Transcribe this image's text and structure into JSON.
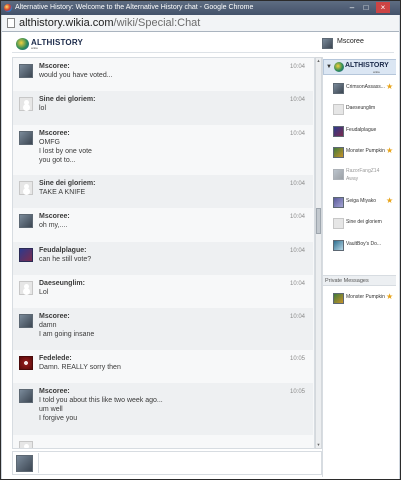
{
  "window": {
    "title": "Alternative History: Welcome to the Alternative History chat - Google Chrome"
  },
  "browser": {
    "url_host": "althistory.wikia.com",
    "url_path": "/wiki/Special:Chat"
  },
  "header": {
    "logo_text": "ALTHISTORY",
    "logo_sub": "wikia",
    "username": "Mscoree"
  },
  "messages": [
    {
      "name": "Mscoree:",
      "time": "10:04",
      "lines": [
        "would you have voted..."
      ],
      "avatar": "mscoree"
    },
    {
      "name": "Sine dei gloriem:",
      "time": "10:04",
      "lines": [
        "lol"
      ],
      "avatar": "generic"
    },
    {
      "name": "Mscoree:",
      "time": "10:04",
      "lines": [
        "OMFG",
        "I lost by one vote",
        "you got to..."
      ],
      "avatar": "mscoree"
    },
    {
      "name": "Sine dei gloriem:",
      "time": "10:04",
      "lines": [
        "TAKE A KNIFE"
      ],
      "avatar": "generic"
    },
    {
      "name": "Mscoree:",
      "time": "10:04",
      "lines": [
        "oh my,...."
      ],
      "avatar": "mscoree"
    },
    {
      "name": "Feudalplague:",
      "time": "10:04",
      "lines": [
        "can he still vote?"
      ],
      "avatar": "feudal"
    },
    {
      "name": "Daeseunglim:",
      "time": "10:04",
      "lines": [
        "Lol"
      ],
      "avatar": "generic"
    },
    {
      "name": "Mscoree:",
      "time": "10:04",
      "lines": [
        "damn",
        "I am going insane"
      ],
      "avatar": "mscoree"
    },
    {
      "name": "Fedelede:",
      "time": "10:05",
      "lines": [
        "Damn. REALLY sorry then"
      ],
      "avatar": "fedelede"
    },
    {
      "name": "Mscoree:",
      "time": "10:05",
      "lines": [
        "I told you about this like two week ago...",
        "um well",
        "I forgive you"
      ],
      "avatar": "mscoree"
    },
    {
      "name": "",
      "time": "",
      "lines": [],
      "avatar": "generic"
    }
  ],
  "sidebar": {
    "room_name": "ALTHISTORY",
    "room_sub": "wikia",
    "users": [
      {
        "name": "CrimsonAssass...",
        "star": true
      },
      {
        "name": "Daeseunglim",
        "star": false
      },
      {
        "name": "Feudalplague",
        "star": false
      },
      {
        "name": "Monster Pumpkin",
        "star": true
      },
      {
        "name": "RazorFangZ14",
        "status": "Away",
        "star": false
      },
      {
        "name": "Seiga Miyako",
        "star": true
      },
      {
        "name": "Sine dei gloriem",
        "star": false
      },
      {
        "name": "VaultBoy's Do...",
        "star": false
      }
    ],
    "pm_header": "Private Messages",
    "pm_users": [
      {
        "name": "Monster Pumpkin",
        "star": true
      }
    ]
  },
  "input": {
    "placeholder": ""
  },
  "icons": {
    "star": "star-icon",
    "arrow": "triangle-down-icon"
  },
  "colors": {
    "titlebar": "#4b5a70",
    "star": "#e8a317",
    "room_highlight": "#dbe6f3"
  }
}
